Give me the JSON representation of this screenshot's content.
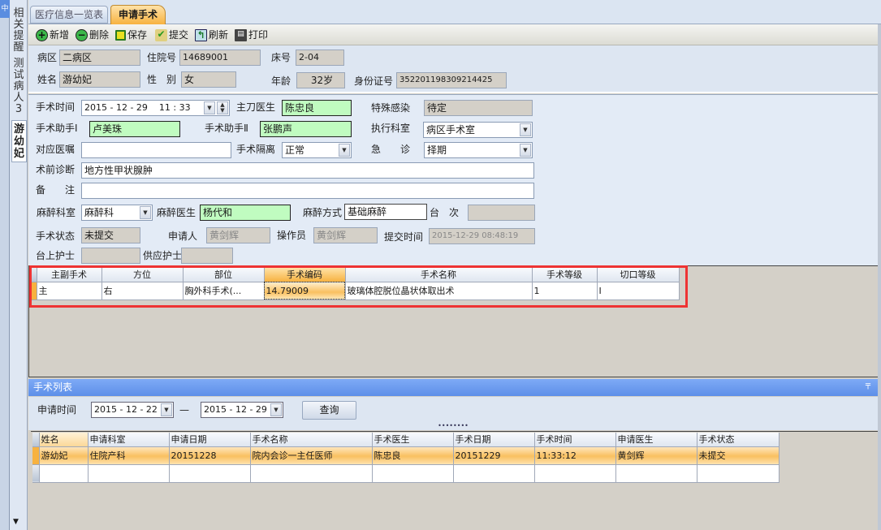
{
  "side_tabs": [
    {
      "label": "相关提醒"
    },
    {
      "label": "测试病人3"
    },
    {
      "label": "游幼妃"
    }
  ],
  "tabs": [
    {
      "label": "医疗信息一览表"
    },
    {
      "label": "申请手术"
    }
  ],
  "toolbar": [
    {
      "label": "新增",
      "icon": "add-icon"
    },
    {
      "label": "删除",
      "icon": "delete-icon"
    },
    {
      "label": "保存",
      "icon": "save-icon"
    },
    {
      "label": "提交",
      "icon": "submit-icon"
    },
    {
      "label": "刷新",
      "icon": "refresh-icon"
    },
    {
      "label": "打印",
      "icon": "print-icon"
    }
  ],
  "patient": {
    "ward_label": "病区",
    "ward": "二病区",
    "admission_label": "住院号",
    "admission": "14689001",
    "bed_label": "床号",
    "bed": "2-04",
    "name_label": "姓名",
    "name": "游幼妃",
    "sex_label": "性　别",
    "sex": "女",
    "age_label": "年龄",
    "age": "32岁",
    "id_label": "身份证号",
    "id": "352201198309214425"
  },
  "form": {
    "time_label": "手术时间",
    "time": "2015 - 12 - 29    11 : 33",
    "surgeon_label": "主刀医生",
    "surgeon": "陈忠良",
    "infection_label": "特殊感染",
    "infection": "待定",
    "asst1_label": "手术助手Ⅰ",
    "asst1": "卢美珠",
    "asst2_label": "手术助手Ⅱ",
    "asst2": "张鹏声",
    "dept_label": "执行科室",
    "dept": "病区手术室",
    "order_label": "对应医嘱",
    "order": "",
    "isolation_label": "手术隔离",
    "isolation": "正常",
    "emergency_label": "急　　诊",
    "emergency": "择期",
    "diagnosis_label": "术前诊断",
    "diagnosis": "地方性甲状腺肿",
    "remark_label": "备　　注",
    "remark": "",
    "anes_dept_label": "麻醉科室",
    "anes_dept": "麻醉科",
    "anes_doctor_label": "麻醉医生",
    "anes_doctor": "杨代和",
    "anes_method_label": "麻醉方式",
    "anes_method": "基础麻醉",
    "table_no_label": "台　次",
    "table_no": "",
    "status_label": "手术状态",
    "status": "未提交",
    "applicant_label": "申请人",
    "applicant": "黄剑辉",
    "operator_label": "操作员",
    "operator": "黄剑辉",
    "submit_time_label": "提交时间",
    "submit_time": "2015-12-29 08:48:19",
    "nurse_label": "台上护士",
    "nurse": "",
    "supply_nurse_label": "供应护士",
    "supply_nurse": ""
  },
  "op_grid": {
    "columns": [
      "主副手术",
      "方位",
      "部位",
      "手术编码",
      "手术名称",
      "手术等级",
      "切口等级"
    ],
    "rows": [
      [
        "主",
        "右",
        "胸外科手术(...",
        "14.79009",
        "玻璃体腔脱位晶状体取出术",
        "1",
        "I"
      ]
    ]
  },
  "list": {
    "title": "手术列表",
    "date_label": "申请时间",
    "from": "2015 - 12 - 22",
    "dash": "—",
    "to": "2015 - 12 - 29",
    "query": "查询",
    "columns": [
      "姓名",
      "申请科室",
      "申请日期",
      "手术名称",
      "手术医生",
      "手术日期",
      "手术时间",
      "申请医生",
      "手术状态"
    ],
    "rows": [
      [
        "游幼妃",
        "住院产科",
        "20151228",
        "院内会诊一主任医师",
        "陈忠良",
        "20151229",
        "11:33:12",
        "黄剑辉",
        "未提交"
      ]
    ]
  },
  "colors": {
    "accent": "#f7b240",
    "header_blue": "#6a9cf0",
    "highlight_red": "#ee3333",
    "required_green": "#c0fcc0"
  }
}
